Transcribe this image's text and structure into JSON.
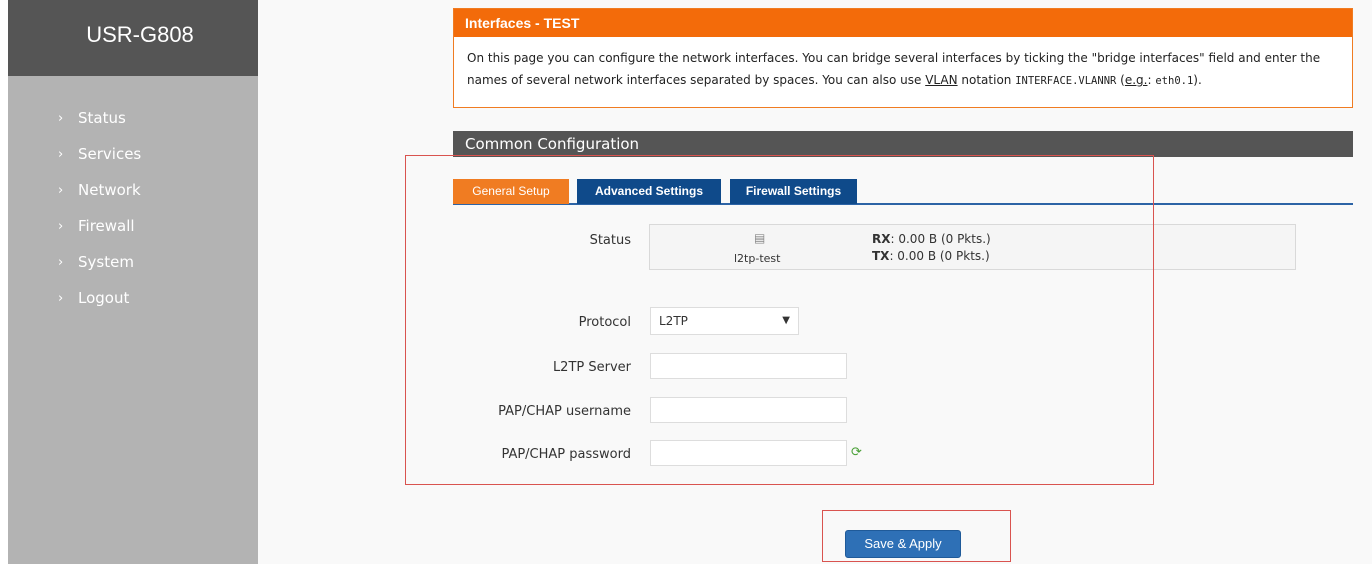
{
  "app": {
    "title": "USR-G808"
  },
  "sidebar": {
    "items": [
      {
        "label": "Status"
      },
      {
        "label": "Services"
      },
      {
        "label": "Network"
      },
      {
        "label": "Firewall"
      },
      {
        "label": "System"
      },
      {
        "label": "Logout"
      }
    ]
  },
  "intro": {
    "title": "Interfaces - TEST",
    "text_part1": "On this page you can configure the network interfaces. You can bridge several interfaces by ticking the \"bridge interfaces\" field and enter the names of several network interfaces separated by spaces. You can also use ",
    "vlan": "VLAN",
    "text_part2": " notation ",
    "notation": "INTERFACE.VLANNR",
    "text_part3": " (",
    "eg": "e.g.",
    "text_part4": ": ",
    "example": "eth0.1",
    "text_part5": ")."
  },
  "section": {
    "title": "Common Configuration"
  },
  "tabs": [
    {
      "label": "General Setup",
      "active": true
    },
    {
      "label": "Advanced Settings",
      "active": false
    },
    {
      "label": "Firewall Settings",
      "active": false
    }
  ],
  "status": {
    "label": "Status",
    "interface_name": "l2tp-test",
    "rx_label": "RX",
    "rx_value": ": 0.00 B (0 Pkts.)",
    "tx_label": "TX",
    "tx_value": ": 0.00 B (0 Pkts.)"
  },
  "form": {
    "protocol_label": "Protocol",
    "protocol_value": "L2TP",
    "server_label": "L2TP Server",
    "server_value": "",
    "username_label": "PAP/CHAP username",
    "username_value": "",
    "password_label": "PAP/CHAP password",
    "password_value": ""
  },
  "actions": {
    "save_label": "Save & Apply"
  },
  "colors": {
    "accent_orange": "#f36b0a",
    "tab_blue": "#0f4a8a",
    "button_blue": "#2e70b6",
    "sidebar_gray": "#b3b3b3",
    "brand_gray": "#555555",
    "highlight_red": "#d9534f"
  }
}
